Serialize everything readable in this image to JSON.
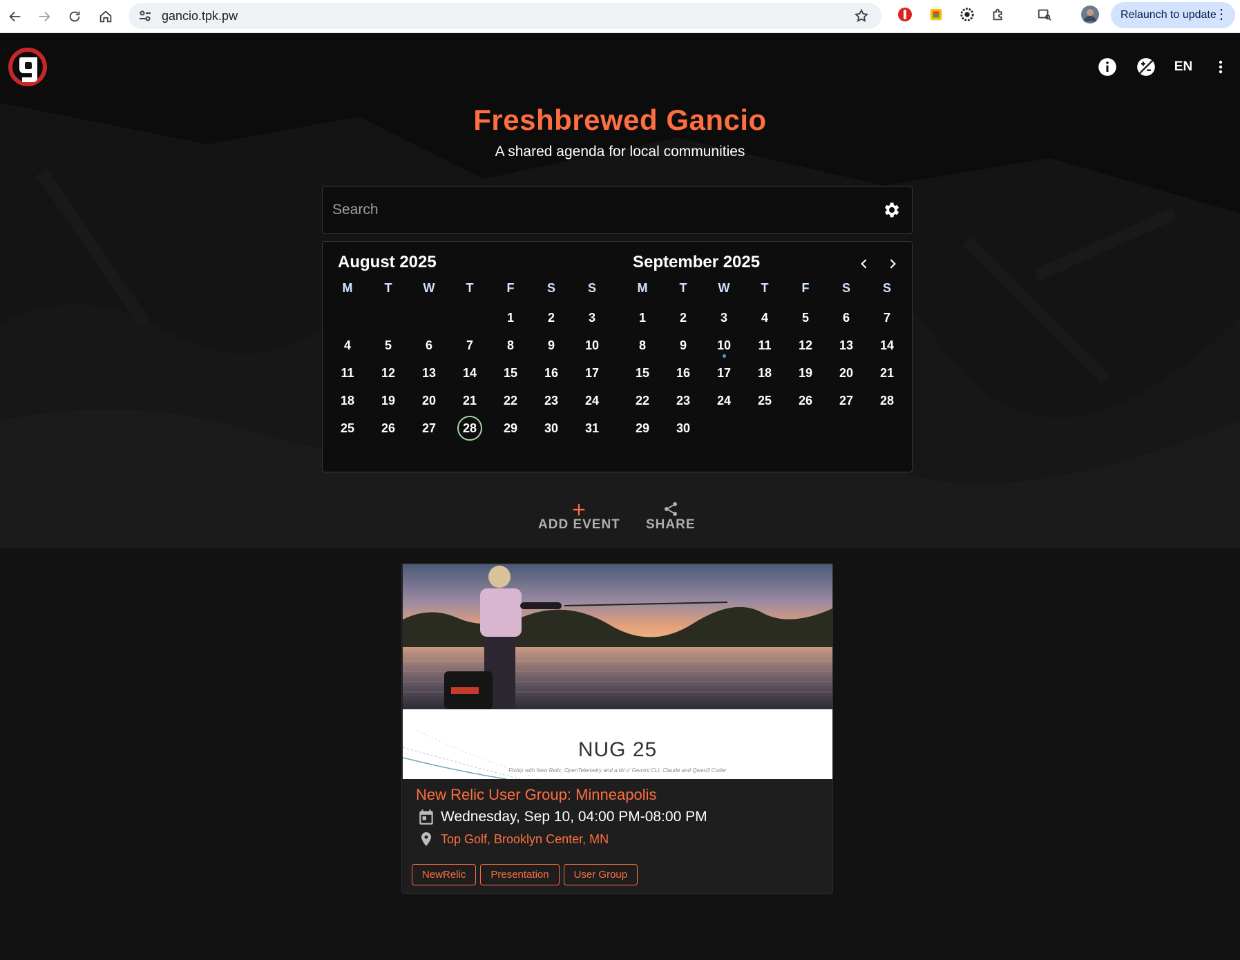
{
  "browser": {
    "url": "gancio.tpk.pw",
    "relaunch_label": "Relaunch to update"
  },
  "header": {
    "language": "EN",
    "title": "Freshbrewed Gancio",
    "subtitle": "A shared agenda for local communities"
  },
  "search": {
    "placeholder": "Search"
  },
  "calendar": {
    "weekday_labels": [
      "M",
      "T",
      "W",
      "T",
      "F",
      "S",
      "S"
    ],
    "months": [
      {
        "title": "August 2025",
        "first_weekday": 4,
        "days": 31,
        "today": 28,
        "event_days": []
      },
      {
        "title": "September 2025",
        "first_weekday": 0,
        "days": 30,
        "today": null,
        "event_days": [
          10
        ]
      }
    ]
  },
  "actions": {
    "add_event": "ADD EVENT",
    "share": "SHARE"
  },
  "event": {
    "banner_title": "NUG 25",
    "banner_subtitle": "Fishin with New Relic, OpenTelemetry and a bit o' Gemini CLI, Claude and Qwen3 Coder",
    "title": "New Relic User Group: Minneapolis",
    "datetime": "Wednesday, Sep 10, 04:00 PM-08:00 PM",
    "place": "Top Golf, Brooklyn Center, MN",
    "tags": [
      "NewRelic",
      "Presentation",
      "User Group"
    ]
  },
  "colors": {
    "accent": "#ff6e40",
    "background": "#121212",
    "weekday": "#cfe3ff",
    "today_ring": "#a5d6a7",
    "event_dot": "#4fa3c7"
  }
}
